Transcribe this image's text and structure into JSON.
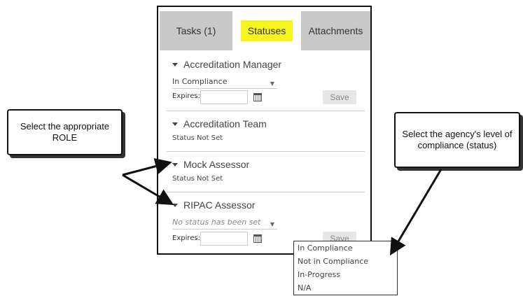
{
  "tabs": [
    {
      "label": "Tasks (1)"
    },
    {
      "label": "Statuses"
    },
    {
      "label": "Attachments"
    }
  ],
  "sections": [
    {
      "title": "Accreditation Manager",
      "status_value": "In Compliance",
      "expires_label": "Expires:",
      "save_label": "Save"
    },
    {
      "title": "Accreditation Team",
      "status_text": "Status Not Set"
    },
    {
      "title": "Mock Assessor",
      "status_text": "Status Not Set"
    },
    {
      "title": "RIPAC Assessor",
      "status_placeholder": "No status has been set",
      "expires_label": "Expires:",
      "save_label": "Save"
    }
  ],
  "dropdown_options": [
    "In Compliance",
    "Not in Compliance",
    "In-Progress",
    "N/A"
  ],
  "callouts": {
    "left": "Select the appropriate ROLE",
    "right": "Select the agency's level of compliance (status)"
  },
  "colors": {
    "tab_highlight": "#f7f31c",
    "tab_bar": "#c8c8c8"
  },
  "icons": [
    "caret-down-icon",
    "calendar-icon",
    "dropdown-arrow-icon"
  ]
}
